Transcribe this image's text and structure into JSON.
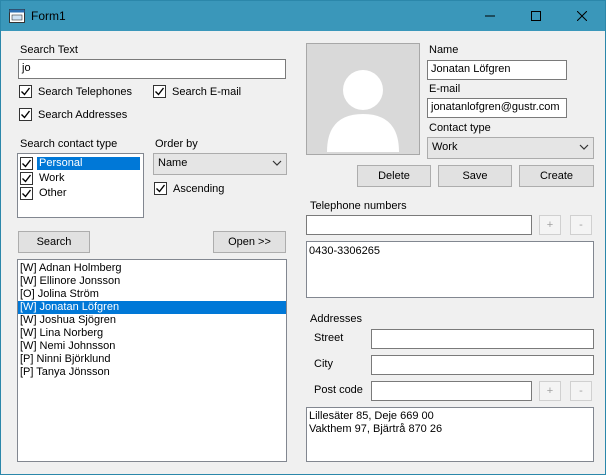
{
  "window": {
    "title": "Form1"
  },
  "search": {
    "label": "Search Text",
    "value": "jo",
    "options": [
      {
        "label": "Search Telephones",
        "checked": true
      },
      {
        "label": "Search E-mail",
        "checked": true
      },
      {
        "label": "Search Addresses",
        "checked": true
      }
    ]
  },
  "contact_type_filter": {
    "label": "Search contact type",
    "items": [
      {
        "label": "Personal",
        "checked": true,
        "selected": true
      },
      {
        "label": "Work",
        "checked": true,
        "selected": false
      },
      {
        "label": "Other",
        "checked": true,
        "selected": false
      }
    ]
  },
  "order": {
    "label": "Order by",
    "value": "Name",
    "ascending_label": "Ascending",
    "ascending": true
  },
  "buttons": {
    "search": "Search",
    "open": "Open >>",
    "delete": "Delete",
    "save": "Save",
    "create": "Create",
    "plus": "+",
    "minus": "-"
  },
  "results": [
    "[W] Adnan Holmberg",
    "[W] Ellinore Jonsson",
    "[O] Jolina Ström",
    "[W] Jonatan Löfgren",
    "[W] Joshua Sjögren",
    "[W] Lina Norberg",
    "[W] Nemi Johnsson",
    "[P] Ninni Björklund",
    "[P] Tanya Jönsson"
  ],
  "selected_result_index": 3,
  "contact": {
    "name_label": "Name",
    "name": "Jonatan Löfgren",
    "email_label": "E-mail",
    "email": "jonatanlofgren@gustr.com",
    "type_label": "Contact type",
    "type": "Work"
  },
  "phones": {
    "label": "Telephone numbers",
    "input": "",
    "items": [
      "0430-3306265"
    ]
  },
  "addresses": {
    "label": "Addresses",
    "street_label": "Street",
    "city_label": "City",
    "postcode_label": "Post code",
    "street": "",
    "city": "",
    "postcode": "",
    "items": [
      "Lillesäter 85, Deje 669 00",
      "Vakthem 97, Bjärtrå 870 26"
    ]
  },
  "colors": {
    "titlebar": "#3a97ba",
    "selection": "#0078d7",
    "client": "#f0f0f0"
  },
  "icons": [
    "app-form-icon",
    "minimize-icon",
    "maximize-icon",
    "close-icon",
    "check-icon",
    "chevron-down-icon",
    "avatar-placeholder-icon"
  ]
}
